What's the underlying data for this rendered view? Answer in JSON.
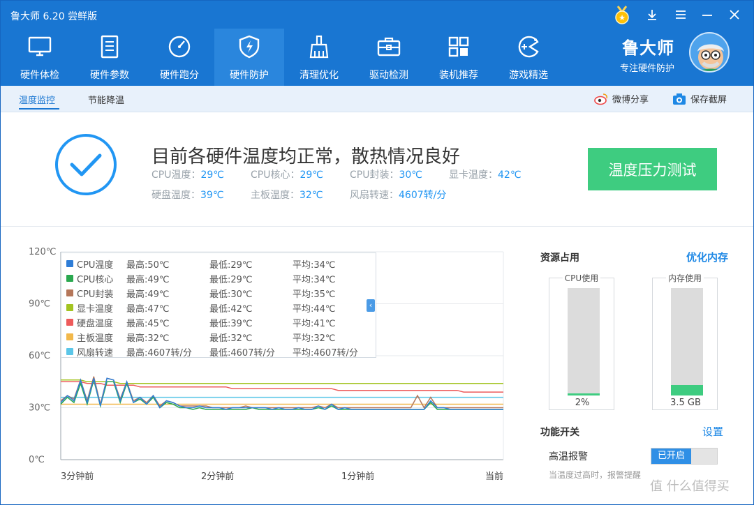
{
  "app": {
    "title": "鲁大师 6.20 尝鲜版"
  },
  "window_controls": [
    "medal-icon",
    "download-icon",
    "menu-icon",
    "minimize-icon",
    "close-icon"
  ],
  "toolbar": [
    {
      "label": "硬件体检",
      "icon": "monitor-icon"
    },
    {
      "label": "硬件参数",
      "icon": "document-icon"
    },
    {
      "label": "硬件跑分",
      "icon": "gauge-icon"
    },
    {
      "label": "硬件防护",
      "icon": "shield-icon",
      "active": true
    },
    {
      "label": "清理优化",
      "icon": "broom-icon"
    },
    {
      "label": "驱动检测",
      "icon": "toolbox-icon"
    },
    {
      "label": "装机推荐",
      "icon": "grid-icon"
    },
    {
      "label": "游戏精选",
      "icon": "gamepad-icon"
    }
  ],
  "brand": {
    "name": "鲁大师",
    "slogan": "专注硬件防护"
  },
  "subtabs": [
    {
      "label": "温度监控",
      "active": true
    },
    {
      "label": "节能降温"
    }
  ],
  "subactions": {
    "weibo": "微博分享",
    "screenshot": "保存截屏"
  },
  "status": {
    "headline": "目前各硬件温度均正常，散热情况良好",
    "metrics_row1": [
      {
        "label": "CPU温度：",
        "value": "29℃"
      },
      {
        "label": "CPU核心：",
        "value": "29℃"
      },
      {
        "label": "CPU封装：",
        "value": "30℃"
      },
      {
        "label": "显卡温度：",
        "value": "42℃"
      }
    ],
    "metrics_row2": [
      {
        "label": "硬盘温度：",
        "value": "39℃"
      },
      {
        "label": "主板温度：",
        "value": "32℃"
      },
      {
        "label": "风扇转速：",
        "value": "4607转/分"
      }
    ],
    "stress_button": "温度压力测试"
  },
  "legend": [
    {
      "name": "CPU温度",
      "max": "最高:50℃",
      "min": "最低:29℃",
      "avg": "平均:34℃",
      "color": "#2e7dd7"
    },
    {
      "name": "CPU核心",
      "max": "最高:49℃",
      "min": "最低:29℃",
      "avg": "平均:34℃",
      "color": "#2aa84f"
    },
    {
      "name": "CPU封装",
      "max": "最高:49℃",
      "min": "最低:30℃",
      "avg": "平均:35℃",
      "color": "#b5775a"
    },
    {
      "name": "显卡温度",
      "max": "最高:47℃",
      "min": "最低:42℃",
      "avg": "平均:44℃",
      "color": "#a3c421"
    },
    {
      "name": "硬盘温度",
      "max": "最高:45℃",
      "min": "最低:39℃",
      "avg": "平均:41℃",
      "color": "#ee5b5b"
    },
    {
      "name": "主板温度",
      "max": "最高:32℃",
      "min": "最低:32℃",
      "avg": "平均:32℃",
      "color": "#f2b84b"
    },
    {
      "name": "风扇转速",
      "max": "最高:4607转/分",
      "min": "最低:4607转/分",
      "avg": "平均:4607转/分",
      "color": "#5bc6e8"
    }
  ],
  "chart_data": {
    "type": "line",
    "ylim": [
      0,
      120
    ],
    "yticks": [
      "0℃",
      "30℃",
      "60℃",
      "90℃",
      "120℃"
    ],
    "ytick_values": [
      0,
      30,
      60,
      90,
      120
    ],
    "xticks": [
      "3分钟前",
      "2分钟前",
      "1分钟前",
      "当前"
    ],
    "series": [
      {
        "name": "CPU温度",
        "color": "#2e7dd7",
        "flat_after": 30,
        "values": [
          33,
          37,
          34,
          46,
          33,
          47,
          31,
          47,
          46,
          34,
          45,
          33,
          36,
          32,
          37,
          30,
          34,
          33,
          31,
          30,
          30,
          31,
          30,
          30,
          30,
          29,
          30,
          30,
          30,
          30,
          30,
          30,
          29,
          30,
          29,
          29,
          30,
          29,
          29,
          31,
          29,
          32,
          29,
          30,
          29,
          29,
          29,
          29,
          29,
          29,
          29,
          29,
          29,
          29,
          29,
          29,
          34,
          30,
          30,
          29,
          29,
          29,
          29,
          29,
          29,
          29,
          29,
          29
        ]
      },
      {
        "name": "CPU核心",
        "color": "#2aa84f",
        "values": [
          32,
          36,
          33,
          44,
          32,
          46,
          31,
          45,
          45,
          33,
          44,
          33,
          35,
          32,
          36,
          30,
          33,
          32,
          30,
          30,
          29,
          30,
          29,
          29,
          29,
          29,
          29,
          29,
          29,
          30,
          29,
          29,
          29,
          29,
          29,
          29,
          29,
          29,
          29,
          30,
          29,
          31,
          29,
          29,
          29,
          29,
          29,
          29,
          29,
          29,
          29,
          29,
          29,
          29,
          29,
          29,
          33,
          29,
          29,
          29,
          29,
          29,
          29,
          29,
          29,
          29,
          29,
          29
        ]
      },
      {
        "name": "CPU封装",
        "color": "#b5775a",
        "values": [
          34,
          37,
          35,
          46,
          34,
          48,
          32,
          47,
          46,
          35,
          45,
          34,
          36,
          33,
          37,
          31,
          34,
          33,
          31,
          31,
          31,
          31,
          31,
          30,
          30,
          30,
          30,
          30,
          31,
          30,
          30,
          30,
          30,
          30,
          30,
          30,
          30,
          30,
          30,
          31,
          30,
          32,
          30,
          30,
          30,
          30,
          30,
          30,
          30,
          30,
          30,
          30,
          30,
          30,
          37,
          30,
          36,
          30,
          30,
          30,
          30,
          30,
          30,
          30,
          30,
          30,
          30,
          30
        ]
      },
      {
        "name": "显卡温度",
        "color": "#a3c421",
        "values": [
          46,
          46,
          46,
          46,
          45,
          45,
          45,
          45,
          45,
          44,
          44,
          44,
          44,
          44,
          44,
          44,
          44,
          44,
          44,
          44,
          44,
          44,
          44,
          44,
          44,
          44,
          44,
          44,
          44,
          44,
          44,
          44,
          44,
          44,
          44,
          44,
          44,
          44,
          44,
          44,
          44,
          44,
          44,
          44,
          44,
          44,
          44,
          44,
          44,
          44,
          44,
          44,
          44,
          44,
          44,
          44,
          44,
          44,
          44,
          44,
          44,
          44,
          44,
          44,
          44,
          44,
          44,
          44
        ]
      },
      {
        "name": "硬盘温度",
        "color": "#ee5b5b",
        "values": [
          45,
          45,
          45,
          45,
          44,
          44,
          44,
          43,
          43,
          43,
          43,
          43,
          42,
          42,
          42,
          42,
          42,
          42,
          42,
          42,
          42,
          42,
          42,
          42,
          42,
          42,
          41,
          41,
          41,
          41,
          41,
          41,
          41,
          41,
          41,
          41,
          41,
          41,
          41,
          41,
          41,
          41,
          40,
          40,
          40,
          40,
          40,
          40,
          40,
          40,
          40,
          40,
          40,
          40,
          40,
          40,
          40,
          40,
          40,
          40,
          40,
          39,
          39,
          39,
          39,
          39,
          39,
          39
        ]
      },
      {
        "name": "主板温度",
        "color": "#f2b84b",
        "values": [
          32,
          32,
          32,
          32,
          32,
          32,
          32,
          32,
          32,
          32,
          32,
          32,
          32,
          32,
          32,
          32,
          32,
          32,
          32,
          32,
          32,
          32,
          32,
          32,
          32,
          32,
          32,
          32,
          32,
          32,
          32,
          32,
          32,
          32,
          32,
          32,
          32,
          32,
          32,
          32,
          32,
          32,
          32,
          32,
          32,
          32,
          32,
          32,
          32,
          32,
          32,
          32,
          32,
          32,
          32,
          32,
          32,
          32,
          32,
          32,
          32,
          32,
          32,
          32,
          32,
          32,
          32,
          32
        ]
      },
      {
        "name": "风扇转速",
        "color": "#5bc6e8",
        "values": [
          36,
          36,
          36,
          36,
          36,
          36,
          36,
          36,
          36,
          36,
          36,
          36,
          36,
          36,
          36,
          36,
          36,
          36,
          36,
          36,
          36,
          36,
          36,
          36,
          36,
          36,
          36,
          36,
          36,
          36,
          36,
          36,
          36,
          36,
          36,
          36,
          36,
          36,
          36,
          36,
          36,
          36,
          36,
          36,
          36,
          36,
          36,
          36,
          36,
          36,
          36,
          36,
          36,
          36,
          36,
          36,
          36,
          36,
          36,
          36,
          36,
          36,
          36,
          36,
          36,
          36,
          36,
          36
        ]
      }
    ]
  },
  "resources": {
    "title": "资源占用",
    "optimize": "优化内存",
    "cpu": {
      "label": "CPU使用",
      "value": "2%",
      "level": 0.02
    },
    "mem": {
      "label": "内存使用",
      "value": "3.5 GB",
      "level": 0.1
    }
  },
  "functions": {
    "title": "功能开关",
    "settings": "设置",
    "alarm_label": "高温报警",
    "alarm_state": "已开启",
    "alarm_note": "当温度过高时，报警提醒"
  },
  "watermark": "值 什么值得买"
}
